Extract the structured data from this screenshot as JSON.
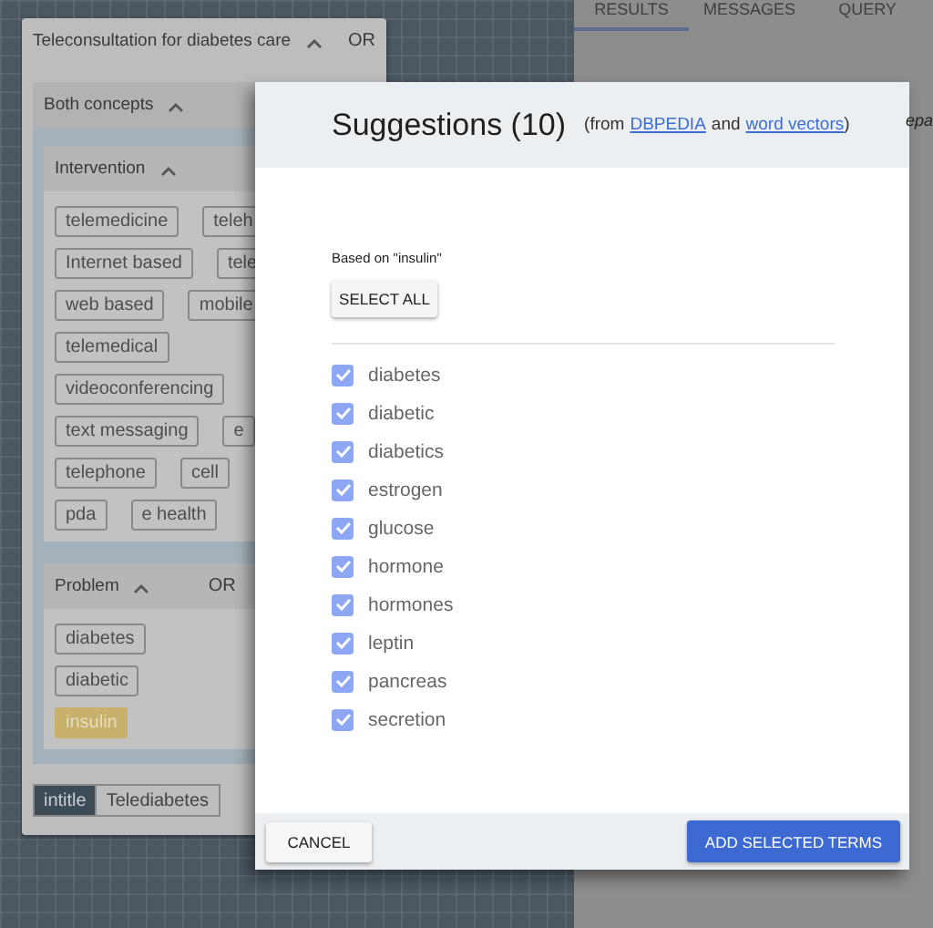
{
  "right_panel": {
    "tabs": [
      {
        "label": "RESULTS",
        "selected": true
      },
      {
        "label": "MESSAGES",
        "selected": false
      },
      {
        "label": "QUERY",
        "selected": false
      }
    ],
    "fragment": "epa"
  },
  "card": {
    "title": "Teleconsultation for diabetes care",
    "expanded": true,
    "operator": "OR",
    "group": {
      "title": "Both concepts",
      "expanded": true,
      "concepts": [
        {
          "title": "Intervention",
          "expanded": true,
          "chip_rows": [
            [
              {
                "label": "telemedicine",
                "highlighted": false
              },
              {
                "label": "teleh",
                "highlighted": false
              }
            ],
            [
              {
                "label": "Internet based",
                "highlighted": false
              },
              {
                "label": "tele",
                "highlighted": false
              }
            ],
            [
              {
                "label": "web based",
                "highlighted": false
              },
              {
                "label": "mobile",
                "highlighted": false
              }
            ],
            [
              {
                "label": "telemedical",
                "highlighted": false
              }
            ],
            [
              {
                "label": "videoconferencing",
                "highlighted": false
              }
            ],
            [
              {
                "label": "text messaging",
                "highlighted": false
              },
              {
                "label": "e",
                "highlighted": false
              }
            ],
            [
              {
                "label": "telephone",
                "highlighted": false
              },
              {
                "label": "cell",
                "highlighted": false
              }
            ],
            [
              {
                "label": "pda",
                "highlighted": false
              },
              {
                "label": "e health",
                "highlighted": false
              }
            ]
          ]
        },
        {
          "title": "Problem",
          "expanded": true,
          "operator": "OR",
          "chip_rows": [
            [
              {
                "label": "diabetes",
                "highlighted": false
              }
            ],
            [
              {
                "label": "diabetic",
                "highlighted": false
              }
            ],
            [
              {
                "label": "insulin",
                "highlighted": true
              }
            ]
          ]
        }
      ]
    },
    "field_toggle": [
      {
        "label": "intitle",
        "selected": true
      },
      {
        "label": "Telediabetes",
        "selected": false
      }
    ]
  },
  "dialog": {
    "title": "Suggestions (10)",
    "source_prefix": "(from",
    "source_link_1": "DBPEDIA",
    "source_and": "and",
    "source_link_2": "word vectors",
    "source_suffix": ")",
    "based_on": "Based on \"insulin\"",
    "select_all": "SELECT ALL",
    "terms": [
      {
        "label": "diabetes",
        "checked": true
      },
      {
        "label": "diabetic",
        "checked": true
      },
      {
        "label": "diabetics",
        "checked": true
      },
      {
        "label": "estrogen",
        "checked": true
      },
      {
        "label": "glucose",
        "checked": true
      },
      {
        "label": "hormone",
        "checked": true
      },
      {
        "label": "hormones",
        "checked": true
      },
      {
        "label": "leptin",
        "checked": true
      },
      {
        "label": "pancreas",
        "checked": true
      },
      {
        "label": "secretion",
        "checked": true
      }
    ],
    "cancel": "CANCEL",
    "confirm": "ADD SELECTED TERMS"
  }
}
